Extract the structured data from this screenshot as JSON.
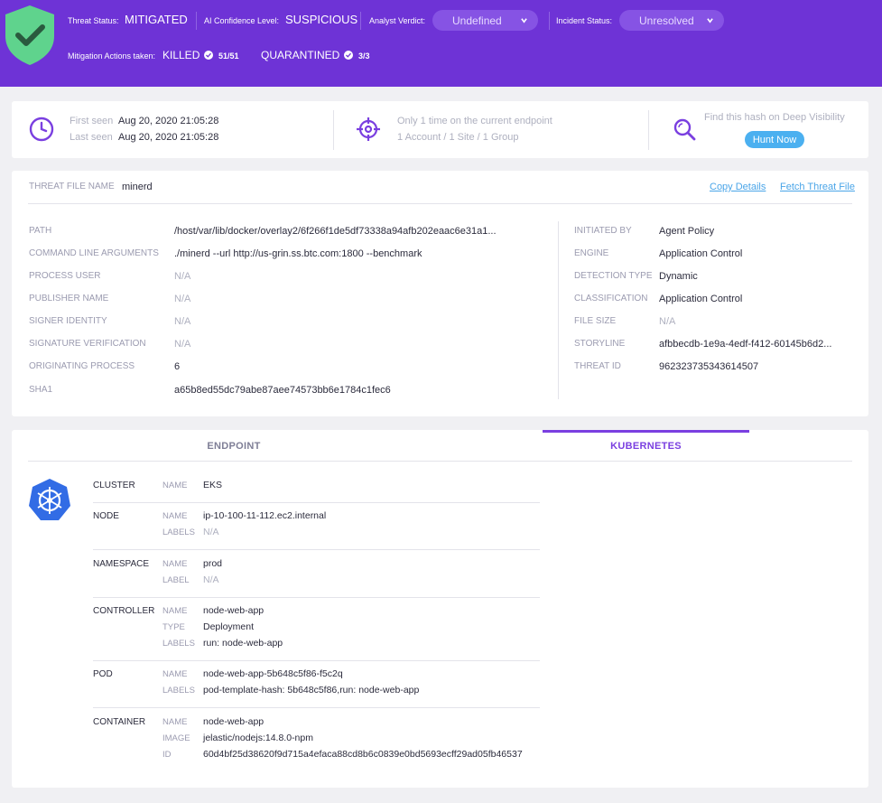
{
  "header": {
    "threat_status_label": "Threat Status:",
    "threat_status_value": "MITIGATED",
    "ai_confidence_label": "AI Confidence Level:",
    "ai_confidence_value": "SUSPICIOUS",
    "analyst_verdict_label": "Analyst Verdict:",
    "analyst_verdict_value": "Undefined",
    "incident_status_label": "Incident Status:",
    "incident_status_value": "Unresolved",
    "mitigation_label": "Mitigation Actions taken:",
    "killed_label": "KILLED",
    "killed_count": "51/51",
    "quarantined_label": "QUARANTINED",
    "quarantined_count": "3/3",
    "colors": {
      "background": "#6e33d6",
      "shield": "#5fd38d"
    }
  },
  "summary": {
    "first_seen_label": "First seen",
    "first_seen_value": "Aug 20, 2020 21:05:28",
    "last_seen_label": "Last seen",
    "last_seen_value": "Aug 20, 2020 21:05:28",
    "endpoint_line1": "Only 1 time on the current endpoint",
    "endpoint_line2": "1 Account / 1 Site / 1 Group",
    "hash_text": "Find this hash on Deep Visibility",
    "hunt_button": "Hunt Now"
  },
  "threat_file": {
    "name_label": "THREAT FILE NAME",
    "name_value": "minerd",
    "copy_details": "Copy Details",
    "fetch_file": "Fetch Threat File",
    "left_fields": [
      {
        "label": "PATH",
        "value": "/host/var/lib/docker/overlay2/6f266f1de5df73338a94afb202eaac6e31a1..."
      },
      {
        "label": "COMMAND LINE ARGUMENTS",
        "value": "./minerd --url http://us-grin.ss.btc.com:1800 --benchmark"
      },
      {
        "label": "PROCESS USER",
        "value": "N/A"
      },
      {
        "label": "PUBLISHER NAME",
        "value": "N/A"
      },
      {
        "label": "SIGNER IDENTITY",
        "value": "N/A"
      },
      {
        "label": "SIGNATURE VERIFICATION",
        "value": "N/A"
      },
      {
        "label": "ORIGINATING PROCESS",
        "value": "6"
      },
      {
        "label": "SHA1",
        "value": "a65b8ed55dc79abe87aee74573bb6e1784c1fec6"
      }
    ],
    "right_fields": [
      {
        "label": "INITIATED BY",
        "value": "Agent Policy"
      },
      {
        "label": "ENGINE",
        "value": "Application Control"
      },
      {
        "label": "DETECTION TYPE",
        "value": "Dynamic"
      },
      {
        "label": "CLASSIFICATION",
        "value": "Application Control"
      },
      {
        "label": "FILE SIZE",
        "value": "N/A"
      },
      {
        "label": "STORYLINE",
        "value": "afbbecdb-1e9a-4edf-f412-60145b6d2..."
      },
      {
        "label": "THREAT ID",
        "value": "962323735343614507"
      }
    ]
  },
  "tabs": {
    "endpoint": "ENDPOINT",
    "kubernetes": "KUBERNETES",
    "active": "kubernetes"
  },
  "kubernetes": {
    "cluster": {
      "section": "CLUSTER",
      "name_key": "NAME",
      "name": "EKS"
    },
    "node": {
      "section": "NODE",
      "name_key": "NAME",
      "name": "ip-10-100-11-112.ec2.internal",
      "labels_key": "LABELS",
      "labels": "N/A"
    },
    "namespace": {
      "section": "NAMESPACE",
      "name_key": "NAME",
      "name": "prod",
      "label_key": "LABEL",
      "label": "N/A"
    },
    "controller": {
      "section": "CONTROLLER",
      "name_key": "NAME",
      "name": "node-web-app",
      "type_key": "TYPE",
      "type": "Deployment",
      "labels_key": "LABELS",
      "labels": "run: node-web-app"
    },
    "pod": {
      "section": "POD",
      "name_key": "NAME",
      "name": "node-web-app-5b648c5f86-f5c2q",
      "labels_key": "LABELS",
      "labels": "pod-template-hash: 5b648c5f86,run: node-web-app"
    },
    "container": {
      "section": "CONTAINER",
      "name_key": "NAME",
      "name": "node-web-app",
      "image_key": "IMAGE",
      "image": "jelastic/nodejs:14.8.0-npm",
      "id_key": "ID",
      "id": "60d4bf25d38620f9d715a4efaca88cd8b6c0839e0bd5693ecff29ad05fb46537"
    }
  }
}
